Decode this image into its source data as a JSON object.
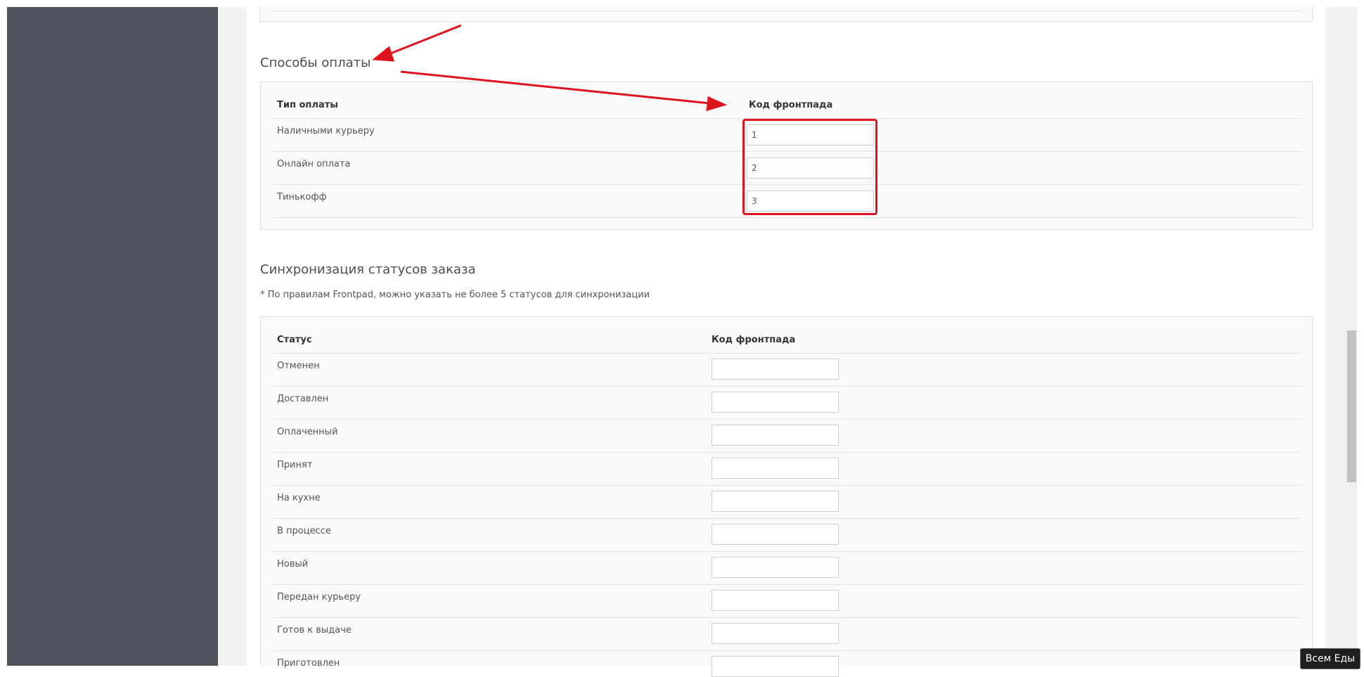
{
  "payment_methods": {
    "title": "Способы оплаты",
    "col_type": "Тип оплаты",
    "col_code": "Код фронтпада",
    "rows": [
      {
        "label": "Наличными курьеру",
        "code": "1"
      },
      {
        "label": "Онлайн оплата",
        "code": "2"
      },
      {
        "label": "Тинькофф",
        "code": "3"
      }
    ]
  },
  "status_sync": {
    "title": "Синхронизация статусов заказа",
    "note": "* По правилам Frontpad, можно указать не более 5 статусов для синхронизации",
    "col_status": "Статус",
    "col_code": "Код фронтпада",
    "rows": [
      {
        "label": "Отменен",
        "code": ""
      },
      {
        "label": "Доставлен",
        "code": ""
      },
      {
        "label": "Оплаченный",
        "code": ""
      },
      {
        "label": "Принят",
        "code": ""
      },
      {
        "label": "На кухне",
        "code": ""
      },
      {
        "label": "В процессе",
        "code": ""
      },
      {
        "label": "Новый",
        "code": ""
      },
      {
        "label": "Передан курьеру",
        "code": ""
      },
      {
        "label": "Готов к выдаче",
        "code": ""
      },
      {
        "label": "Приготовлен",
        "code": ""
      }
    ]
  },
  "badge": {
    "label": "Всем Еды"
  },
  "colors": {
    "sidebar": "#4c535a",
    "annotation": "#e0141e",
    "panel_bg": "#fafafa"
  }
}
